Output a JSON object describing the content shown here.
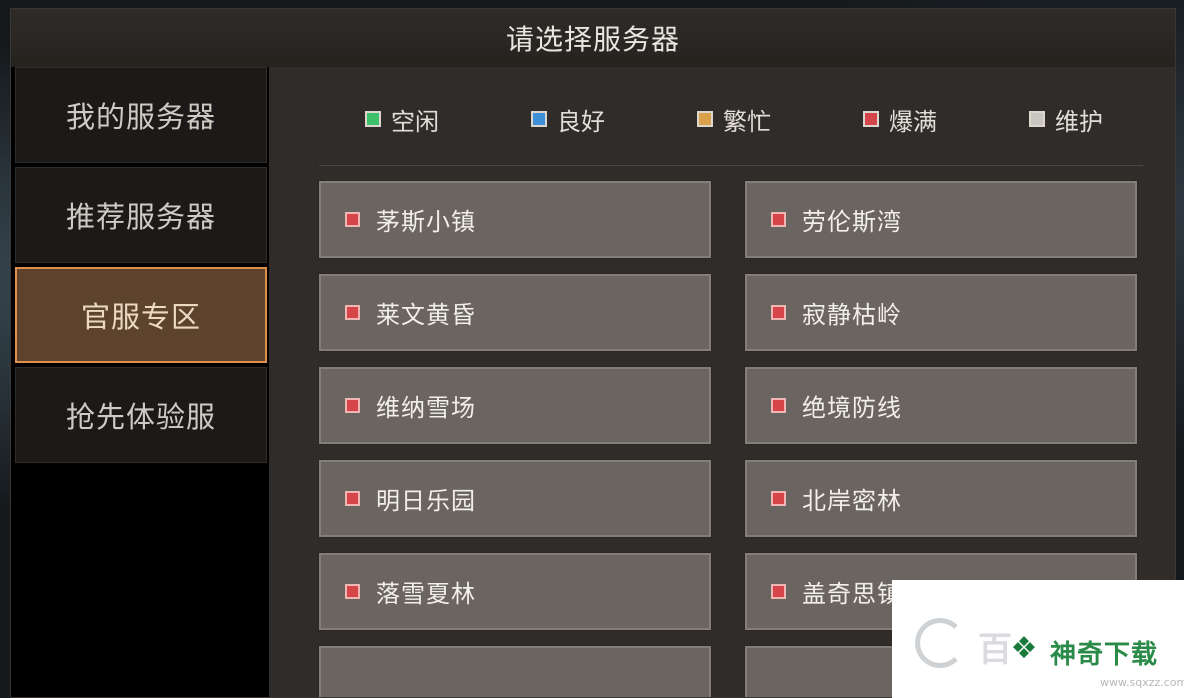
{
  "title": "请选择服务器",
  "sidebar": {
    "items": [
      {
        "label": "我的服务器"
      },
      {
        "label": "推荐服务器"
      },
      {
        "label": "官服专区",
        "active": true
      },
      {
        "label": "抢先体验服"
      }
    ]
  },
  "legend": [
    {
      "label": "空闲",
      "color": "#3cc06a"
    },
    {
      "label": "良好",
      "color": "#3d8fd6"
    },
    {
      "label": "繁忙",
      "color": "#d9a14a"
    },
    {
      "label": "爆满",
      "color": "#d5454a"
    },
    {
      "label": "维护",
      "color": "#c9c6c2"
    }
  ],
  "servers": [
    {
      "name": "茅斯小镇",
      "status": "爆满"
    },
    {
      "name": "劳伦斯湾",
      "status": "爆满"
    },
    {
      "name": "莱文黄昏",
      "status": "爆满"
    },
    {
      "name": "寂静枯岭",
      "status": "爆满"
    },
    {
      "name": "维纳雪场",
      "status": "爆满"
    },
    {
      "name": "绝境防线",
      "status": "爆满"
    },
    {
      "name": "明日乐园",
      "status": "爆满"
    },
    {
      "name": "北岸密林",
      "status": "爆满"
    },
    {
      "name": "落雪夏林",
      "status": "爆满"
    },
    {
      "name": "盖奇思镇",
      "status": "爆满"
    }
  ],
  "watermark": {
    "faded_text": "百",
    "brand_text": "神奇下载",
    "url": "www.sqxzz.com"
  }
}
